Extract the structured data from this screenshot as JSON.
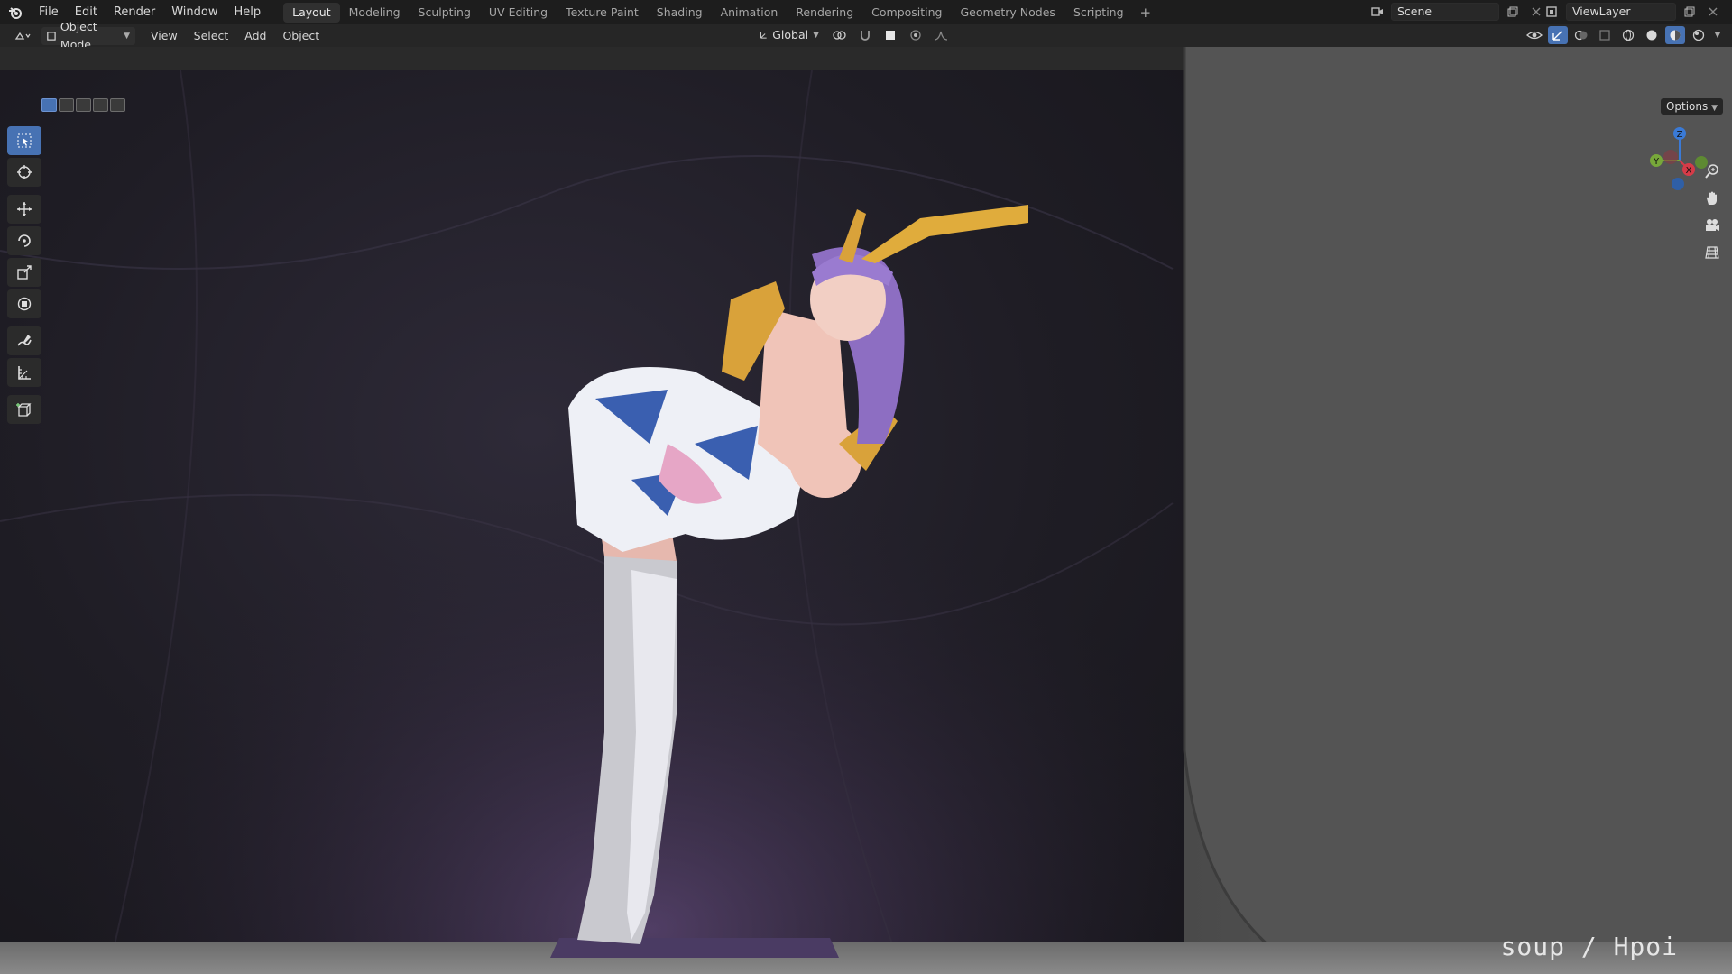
{
  "menu": {
    "items": [
      "File",
      "Edit",
      "Render",
      "Window",
      "Help"
    ]
  },
  "workspaces": {
    "tabs": [
      "Layout",
      "Modeling",
      "Sculpting",
      "UV Editing",
      "Texture Paint",
      "Shading",
      "Animation",
      "Rendering",
      "Compositing",
      "Geometry Nodes",
      "Scripting"
    ],
    "active": "Layout",
    "add_label": "+"
  },
  "scene": {
    "name": "Scene"
  },
  "view_layer": {
    "name": "ViewLayer"
  },
  "viewport_header": {
    "mode": "Object Mode",
    "menus": [
      "View",
      "Select",
      "Add",
      "Object"
    ],
    "transform_orientation": "Global",
    "options_label": "Options"
  },
  "gizmo": {
    "x": "X",
    "y": "Y",
    "z": "Z"
  },
  "watermark": "soup / Hpoi",
  "colors": {
    "accent": "#4772b3",
    "x_axis": "#d63b48",
    "y_axis": "#77a83a",
    "z_axis": "#3a7ad6"
  }
}
